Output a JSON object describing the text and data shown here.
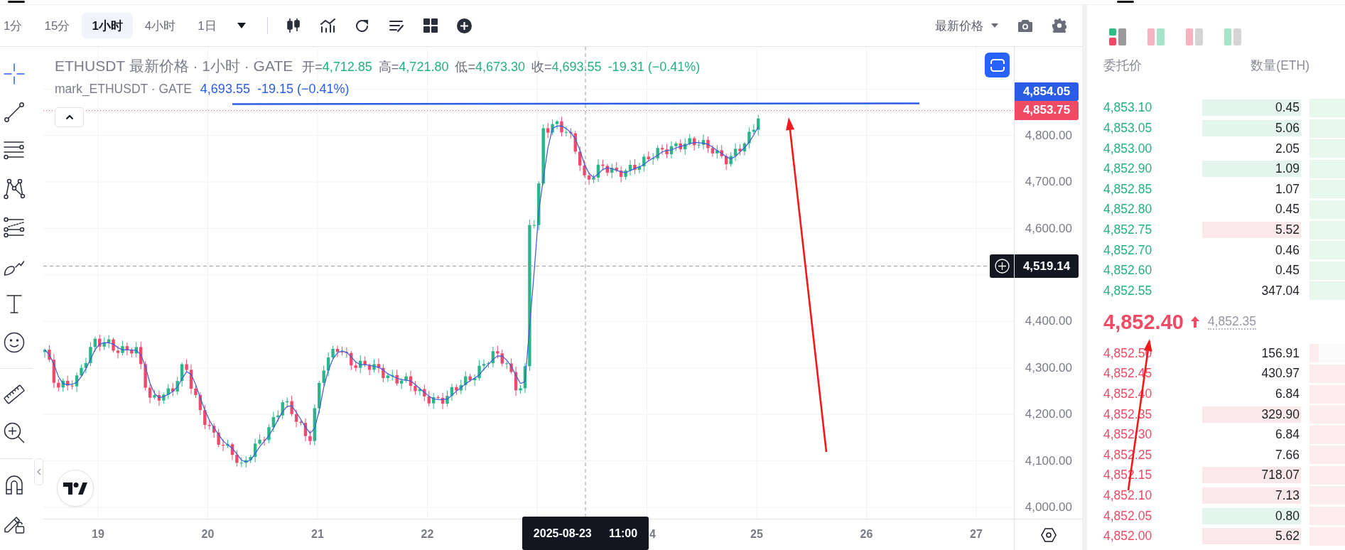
{
  "top_bar": {
    "intervals": [
      {
        "label": "1分",
        "selected": false
      },
      {
        "label": "15分",
        "selected": false
      },
      {
        "label": "1小时",
        "selected": true
      },
      {
        "label": "4小时",
        "selected": false
      },
      {
        "label": "1日",
        "selected": false
      }
    ],
    "price_source": "最新价格"
  },
  "drawing_tools": [
    {
      "selected": true
    },
    {
      "selected": false
    },
    {
      "selected": false
    },
    {
      "selected": false
    },
    {
      "selected": false
    },
    {
      "selected": false
    },
    {
      "selected": false
    },
    {
      "selected": false
    }
  ],
  "chart": {
    "legend": {
      "symbol": "ETHUSDT 最新价格 · 1小时 · GATE",
      "fields": [
        {
          "label": "开=",
          "value": "4,712.85"
        },
        {
          "label": "高=",
          "value": "4,721.80"
        },
        {
          "label": "低=",
          "value": "4,673.30"
        },
        {
          "label": "收=",
          "value": "4,693.55"
        }
      ],
      "change": "-19.31 (−0.41%)"
    },
    "mark_legend": {
      "symbol": "mark_ETHUSDT · GATE",
      "value": "4,693.55",
      "change": "-19.15 (−0.41%)"
    },
    "price_ticks": [
      "4,800.00",
      "4,700.00",
      "4,600.00",
      "4,400.00",
      "4,300.00",
      "4,200.00",
      "4,100.00",
      "4,000.00"
    ],
    "price_labels": [
      {
        "text": "4,854.05",
        "color": "#2b5ce6"
      },
      {
        "text": "4,853.75",
        "color": "#f04a65"
      }
    ],
    "crosshair": {
      "price": "4,519.14",
      "time": "2025-08-23 11:00"
    },
    "time_ticks": [
      "19",
      "20",
      "21",
      "22",
      "4",
      "25",
      "26",
      "27"
    ]
  },
  "order_book": {
    "view_modes": [
      {
        "selected": true
      },
      {
        "selected": false
      },
      {
        "selected": false
      },
      {
        "selected": false
      }
    ],
    "columns": [
      "委托价",
      "数量(ETH)"
    ],
    "asks": [
      {
        "price": "4,853.10",
        "quantity": "0.45",
        "color": "#e3f5ec",
        "level": 1
      },
      {
        "price": "4,853.05",
        "quantity": "5.06",
        "color": "#e3f5ec",
        "level": 1
      },
      {
        "price": "4,853.00",
        "quantity": "2.05",
        "level": 1
      },
      {
        "price": "4,852.90",
        "quantity": "1.09",
        "color": "#e3f5ec",
        "level": 1
      },
      {
        "price": "4,852.85",
        "quantity": "1.07",
        "level": 1
      },
      {
        "price": "4,852.80",
        "quantity": "0.45",
        "level": 1
      },
      {
        "price": "4,852.75",
        "quantity": "5.52",
        "color": "#fbe8ea",
        "level": 1
      },
      {
        "price": "4,852.70",
        "quantity": "0.46",
        "level": 1
      },
      {
        "price": "4,852.60",
        "quantity": "0.45",
        "level": 1
      },
      {
        "price": "4,852.55",
        "quantity": "347.04",
        "level": 1
      }
    ],
    "last_price": "4,852.40",
    "rising": true,
    "mark_price": "4,852.35",
    "bids": [
      {
        "price": "4,852.50",
        "quantity": "156.91",
        "level": 0.26
      },
      {
        "price": "4,852.45",
        "quantity": "430.97",
        "level": 1
      },
      {
        "price": "4,852.40",
        "quantity": "6.84",
        "level": 1
      },
      {
        "price": "4,852.35",
        "quantity": "329.90",
        "color": "#fbe8ea",
        "level": 1
      },
      {
        "price": "4,852.30",
        "quantity": "6.84",
        "level": 1
      },
      {
        "price": "4,852.25",
        "quantity": "7.66",
        "level": 1
      },
      {
        "price": "4,852.15",
        "quantity": "718.07",
        "color": "#fbe8ea",
        "level": 1
      },
      {
        "price": "4,852.10",
        "quantity": "7.13",
        "color": "#fbe8ea",
        "level": 1
      },
      {
        "price": "4,852.05",
        "quantity": "0.80",
        "color": "#e3f5ec",
        "level": 1
      },
      {
        "price": "4,852.00",
        "quantity": "5.62",
        "color": "#fbe8ea",
        "level": 1
      }
    ]
  }
}
